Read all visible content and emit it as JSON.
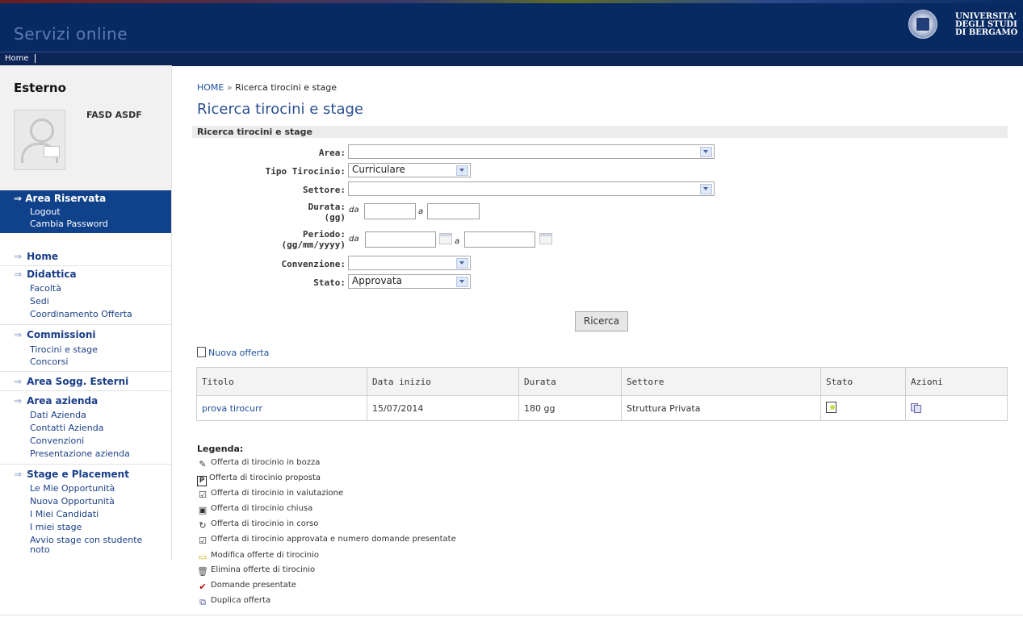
{
  "header": {
    "site_title": "Servizi online",
    "university": [
      "UNIVERSITA'",
      "DEGLI STUDI",
      "DI BERGAMO"
    ],
    "nav_home": "Home"
  },
  "sidebar": {
    "title": "Esterno",
    "user_name": "FASD ASDF",
    "reserved": {
      "label": "Area Riservata",
      "items": [
        "Logout",
        "Cambia Password"
      ]
    },
    "sections": [
      {
        "label": "Home",
        "items": []
      },
      {
        "label": "Didattica",
        "items": [
          "Facoltà",
          "Sedi",
          "Coordinamento Offerta"
        ]
      },
      {
        "label": "Commissioni",
        "items": [
          "Tirocini e stage",
          "Concorsi"
        ]
      },
      {
        "label": "Area Sogg. Esterni",
        "items": []
      },
      {
        "label": "Area azienda",
        "items": [
          "Dati Azienda",
          "Contatti Azienda",
          "Convenzioni",
          "Presentazione azienda"
        ]
      },
      {
        "label": "Stage e Placement",
        "items": [
          "Le Mie Opportunità",
          "Nuova Opportunità",
          "I Miei Candidati",
          "I miei stage",
          "Avvio stage con studente",
          "noto"
        ]
      }
    ]
  },
  "breadcrumb": {
    "home": "HOME",
    "sep": "»",
    "current": "Ricerca tirocini e stage"
  },
  "page_title": "Ricerca tirocini e stage",
  "panel_title": "Ricerca tirocini e stage",
  "form": {
    "area_label": "Area:",
    "area_value": "",
    "tipo_label": "Tipo Tirocinio:",
    "tipo_value": "Curriculare",
    "settore_label": "Settore:",
    "settore_value": "",
    "durata_label_1": "Durata:",
    "durata_label_2": "(gg)",
    "periodo_label_1": "Periodo:",
    "periodo_label_2": "(gg/mm/yyyy)",
    "da": "da",
    "a": "a",
    "convenzione_label": "Convenzione:",
    "convenzione_value": "",
    "stato_label": "Stato:",
    "stato_value": "Approvata",
    "search_button": "Ricerca"
  },
  "new_offer": "Nuova offerta",
  "table": {
    "headers": [
      "Titolo",
      "Data inizio",
      "Durata",
      "Settore",
      "Stato",
      "Azioni"
    ],
    "rows": [
      {
        "titolo": "prova tirocurr",
        "data_inizio": "15/07/2014",
        "durata": "180 gg",
        "settore": "Struttura Privata"
      }
    ]
  },
  "legend": {
    "title": "Legenda:",
    "items": [
      {
        "icon": "draft-edit-icon",
        "text": "Offerta di tirocinio in bozza"
      },
      {
        "icon": "proposed-p-icon",
        "text": "Offerta di tirocinio proposta"
      },
      {
        "icon": "evaluation-icon",
        "text": "Offerta di tirocinio in valutazione"
      },
      {
        "icon": "closed-lock-icon",
        "text": "Offerta di tirocinio chiusa"
      },
      {
        "icon": "in-progress-icon",
        "text": "Offerta di tirocinio in corso"
      },
      {
        "icon": "approved-icon",
        "text": "Offerta di tirocinio approvata e numero domande presentate"
      },
      {
        "icon": "folder-icon",
        "text": "Modifica offerte di tirocinio"
      },
      {
        "icon": "trash-icon",
        "text": "Elimina offerte di tirocinio"
      },
      {
        "icon": "applications-icon",
        "text": "Domande presentate"
      },
      {
        "icon": "duplicate-icon",
        "text": "Duplica offerta"
      }
    ]
  }
}
